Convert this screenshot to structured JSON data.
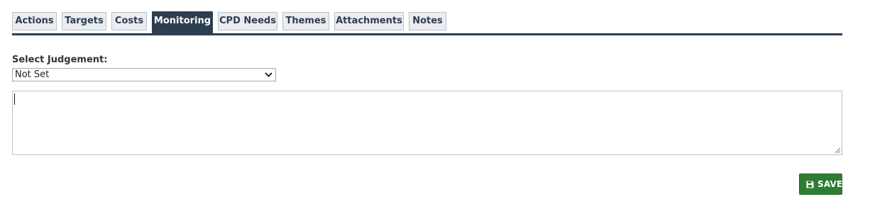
{
  "tabs": [
    {
      "label": "Actions",
      "active": false
    },
    {
      "label": "Targets",
      "active": false
    },
    {
      "label": "Costs",
      "active": false
    },
    {
      "label": "Monitoring",
      "active": true
    },
    {
      "label": "CPD Needs",
      "active": false
    },
    {
      "label": "Themes",
      "active": false
    },
    {
      "label": "Attachments",
      "active": false
    },
    {
      "label": "Notes",
      "active": false
    }
  ],
  "judgement": {
    "label": "Select Judgement:",
    "selected": "Not Set",
    "chevron_icon": "chevron-down-icon"
  },
  "comments": {
    "value": "",
    "resize_icon": "resize-grip-icon"
  },
  "save_button": {
    "label": "SAVE",
    "icon": "floppy-disk-icon",
    "color": "#2e7d32"
  },
  "colors": {
    "tab_active_bg": "#2c3e50",
    "tab_inactive_bg": "#eaecef",
    "tab_text": "#2c3e50"
  }
}
